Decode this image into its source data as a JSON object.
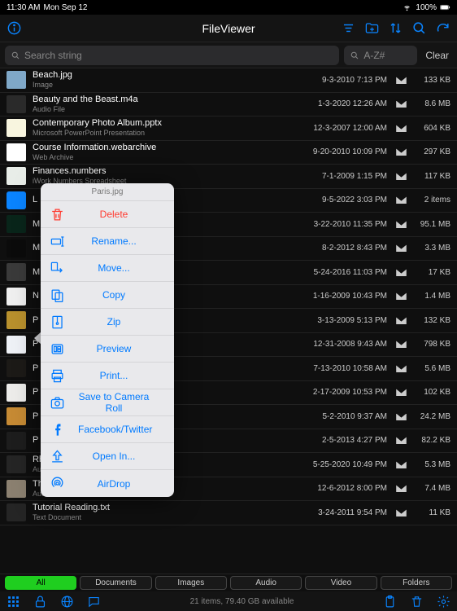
{
  "status": {
    "time": "11:30 AM",
    "date": "Mon Sep 12",
    "battery": "100%"
  },
  "nav": {
    "title": "FileViewer"
  },
  "search": {
    "placeholder": "Search string",
    "filter_placeholder": "A-Z#",
    "clear": "Clear"
  },
  "files": [
    {
      "name": "Beach.jpg",
      "type": "Image",
      "date": "9-3-2010 7:13 PM",
      "size": "133 KB",
      "thumb": "#7fa8c8"
    },
    {
      "name": "Beauty and the Beast.m4a",
      "type": "Audio File",
      "date": "1-3-2020 12:26 AM",
      "size": "8.6 MB",
      "thumb": "#2a2a2a"
    },
    {
      "name": "Contemporary Photo Album.pptx",
      "type": "Microsoft PowerPoint Presentation",
      "date": "12-3-2007 12:00 AM",
      "size": "604 KB",
      "thumb": "#f8f5df"
    },
    {
      "name": "Course Information.webarchive",
      "type": "Web Archive",
      "date": "9-20-2010 10:09 PM",
      "size": "297 KB",
      "thumb": "#ffffff"
    },
    {
      "name": "Finances.numbers",
      "type": "iWork Numbers Spreadsheet",
      "date": "7-1-2009 1:15 PM",
      "size": "117 KB",
      "thumb": "#e8ede8"
    },
    {
      "name": "L",
      "type": "",
      "date": "9-5-2022 3:03 PM",
      "size": "2 items",
      "thumb": "folder"
    },
    {
      "name": "M",
      "type": "",
      "date": "3-22-2010 11:35 PM",
      "size": "95.1 MB",
      "thumb": "#09251a"
    },
    {
      "name": "M",
      "type": "",
      "date": "8-2-2012 8:43 PM",
      "size": "3.3 MB",
      "thumb": "#0b0b0b"
    },
    {
      "name": "M",
      "type": "",
      "date": "5-24-2016 11:03 PM",
      "size": "17 KB",
      "thumb": "#3a3a3a"
    },
    {
      "name": "N",
      "type": "",
      "date": "1-16-2009 10:43 PM",
      "size": "1.4 MB",
      "thumb": "#efefef"
    },
    {
      "name": "P",
      "type": "",
      "date": "3-13-2009 5:13 PM",
      "size": "132 KB",
      "thumb": "#b8902d"
    },
    {
      "name": "P",
      "type": "",
      "date": "12-31-2008 9:43 AM",
      "size": "798 KB",
      "thumb": "#eef1f6"
    },
    {
      "name": "P",
      "type": "",
      "date": "7-13-2010 10:58 AM",
      "size": "5.6 MB",
      "thumb": "#1c1a17"
    },
    {
      "name": "P",
      "type": "",
      "date": "2-17-2009 10:53 PM",
      "size": "102 KB",
      "thumb": "#edecea"
    },
    {
      "name": "P",
      "type": "",
      "date": "5-2-2010 9:37 AM",
      "size": "24.2 MB",
      "thumb": "#c68a34"
    },
    {
      "name": "P",
      "type": "",
      "date": "2-5-2013 4:27 PM",
      "size": "82.2 KB",
      "thumb": "#1d1d1d"
    },
    {
      "name": "RhapsodyInBlue.mp3",
      "type": "Audio File",
      "date": "5-25-2020 10:49 PM",
      "size": "5.3 MB",
      "thumb": "#252525"
    },
    {
      "name": "There You'll Be.m4a",
      "type": "Audio File",
      "date": "12-6-2012 8:00 PM",
      "size": "7.4 MB",
      "thumb": "#8b8070"
    },
    {
      "name": "Tutorial Reading.txt",
      "type": "Text Document",
      "date": "3-24-2011 9:54 PM",
      "size": "11 KB",
      "thumb": "#252525"
    }
  ],
  "tabs": [
    "All",
    "Documents",
    "Images",
    "Audio",
    "Video",
    "Folders"
  ],
  "active_tab": 0,
  "bottom": {
    "status": "21 items, 79.40 GB available"
  },
  "ctx": {
    "title": "Paris.jpg",
    "items": [
      {
        "label": "Delete",
        "icon": "trash",
        "danger": true
      },
      {
        "label": "Rename...",
        "icon": "rename"
      },
      {
        "label": "Move...",
        "icon": "move"
      },
      {
        "label": "Copy",
        "icon": "copy"
      },
      {
        "label": "Zip",
        "icon": "zip"
      },
      {
        "label": "Preview",
        "icon": "preview"
      },
      {
        "label": "Print...",
        "icon": "print"
      },
      {
        "label": "Save to Camera Roll",
        "icon": "camera"
      },
      {
        "label": "Facebook/Twitter",
        "icon": "social"
      },
      {
        "label": "Open In...",
        "icon": "openin"
      },
      {
        "label": "AirDrop",
        "icon": "airdrop"
      }
    ]
  }
}
